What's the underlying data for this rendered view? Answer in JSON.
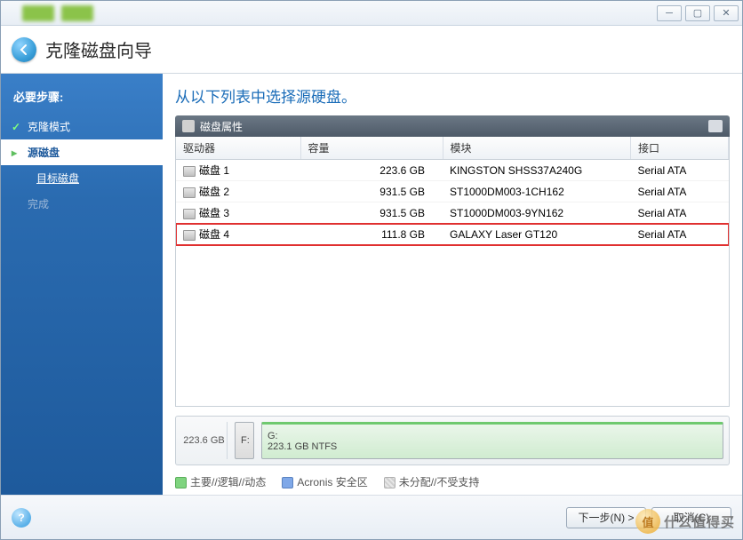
{
  "window": {
    "title": "克隆磁盘向导"
  },
  "sidebar": {
    "heading": "必要步骤:",
    "items": [
      {
        "label": "克隆模式",
        "state": "done"
      },
      {
        "label": "源磁盘",
        "state": "active"
      },
      {
        "label": "目标磁盘",
        "state": "sub"
      },
      {
        "label": "完成",
        "state": "disabled"
      }
    ]
  },
  "main": {
    "title": "从以下列表中选择源硬盘。",
    "panel_title": "磁盘属性",
    "columns": [
      "驱动器",
      "容量",
      "模块",
      "接口"
    ],
    "rows": [
      {
        "drive": "磁盘 1",
        "capacity": "223.6 GB",
        "module": "KINGSTON SHSS37A240G",
        "interface": "Serial ATA",
        "highlight": false
      },
      {
        "drive": "磁盘 2",
        "capacity": "931.5 GB",
        "module": "ST1000DM003-1CH162",
        "interface": "Serial ATA",
        "highlight": false
      },
      {
        "drive": "磁盘 3",
        "capacity": "931.5 GB",
        "module": "ST1000DM003-9YN162",
        "interface": "Serial ATA",
        "highlight": false
      },
      {
        "drive": "磁盘 4",
        "capacity": "111.8 GB",
        "module": "GALAXY Laser GT120",
        "interface": "Serial ATA",
        "highlight": true
      }
    ],
    "viz": {
      "total": "223.6 GB",
      "parts": [
        {
          "label": "F:",
          "sub": ""
        },
        {
          "label": "G:",
          "sub": "223.1 GB  NTFS"
        }
      ]
    },
    "legend": [
      "主要//逻辑//动态",
      "Acronis 安全区",
      "未分配//不受支持"
    ]
  },
  "footer": {
    "next": "下一步(N) >",
    "cancel": "取消(C)"
  },
  "watermark": "什么值得买"
}
